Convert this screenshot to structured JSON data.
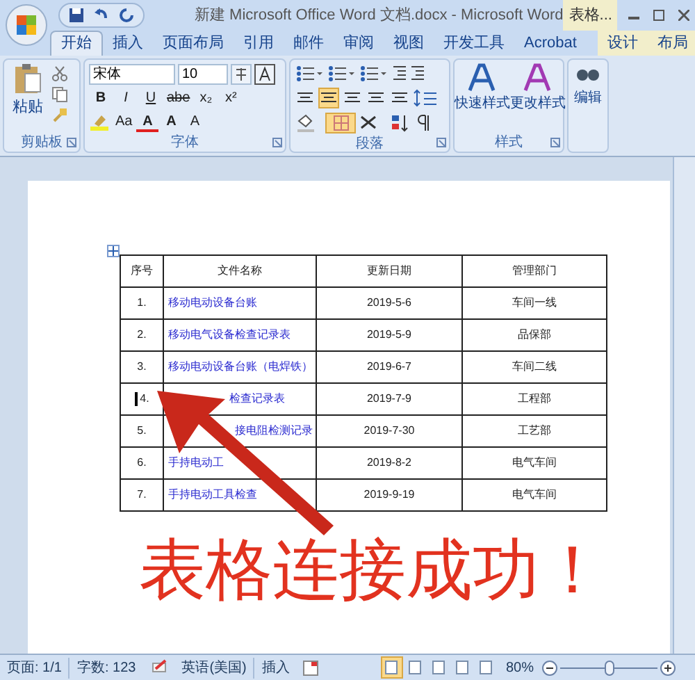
{
  "window": {
    "title": "新建 Microsoft Office Word 文档.docx - Microsoft Word",
    "context_tab": "表格..."
  },
  "tabs": [
    {
      "label": "开始",
      "selected": true,
      "kind": "normal"
    },
    {
      "label": "插入",
      "selected": false,
      "kind": "normal"
    },
    {
      "label": "页面布局",
      "selected": false,
      "kind": "normal"
    },
    {
      "label": "引用",
      "selected": false,
      "kind": "normal"
    },
    {
      "label": "邮件",
      "selected": false,
      "kind": "normal"
    },
    {
      "label": "审阅",
      "selected": false,
      "kind": "normal"
    },
    {
      "label": "视图",
      "selected": false,
      "kind": "normal"
    },
    {
      "label": "开发工具",
      "selected": false,
      "kind": "normal"
    },
    {
      "label": "Acrobat",
      "selected": false,
      "kind": "normal"
    },
    {
      "label": "设计",
      "selected": false,
      "kind": "context"
    },
    {
      "label": "布局",
      "selected": false,
      "kind": "context"
    }
  ],
  "ribbon": {
    "clipboard": {
      "paste": "粘贴",
      "group": "剪贴板"
    },
    "font": {
      "name": "宋体",
      "size": "10",
      "row2": [
        "B",
        "I",
        "U",
        "abe",
        "x₂",
        "x²"
      ],
      "row3": [
        "Aa",
        "A",
        "A",
        "A"
      ],
      "group": "字体"
    },
    "paragraph": {
      "group": "段落",
      "align": [
        {
          "selected": false
        },
        {
          "selected": true
        },
        {
          "selected": false
        },
        {
          "selected": false
        },
        {
          "selected": false
        }
      ],
      "borders_on": true
    },
    "styles": {
      "buttons": [
        "快速样式",
        "更改样式"
      ],
      "group": "样式"
    },
    "editing": {
      "label": "编辑"
    }
  },
  "table": {
    "columns": [
      "序号",
      "文件名称",
      "更新日期",
      "管理部门"
    ],
    "rows": [
      {
        "no": "1.",
        "name": "移动电动设备台账",
        "date": "2019-5-6",
        "dept": "车间一线"
      },
      {
        "no": "2.",
        "name": "移动电气设备检查记录表",
        "date": "2019-5-9",
        "dept": "品保部"
      },
      {
        "no": "3.",
        "name": "移动电动设备台账（电焊铁）",
        "date": "2019-6-7",
        "dept": "车间二线"
      },
      {
        "no": "4.",
        "name": "检查记录表",
        "date": "2019-7-9",
        "dept": "工程部",
        "cursor": true
      },
      {
        "no": "5.",
        "name": "接电阻检测记录",
        "date": "2019-7-30",
        "dept": "工艺部"
      },
      {
        "no": "6.",
        "name": "手持电动工",
        "date": "2019-8-2",
        "dept": "电气车间"
      },
      {
        "no": "7.",
        "name": "手持电动工具检查",
        "date": "2019-9-19",
        "dept": "电气车间"
      }
    ]
  },
  "annotation": {
    "text": "表格连接成功！"
  },
  "status_bar": {
    "page": "页面: 1/1",
    "words": "字数: 123",
    "language": "英语(美国)",
    "mode": "插入",
    "zoom": "80%",
    "views": [
      {
        "selected": true
      },
      {
        "selected": false
      },
      {
        "selected": false
      },
      {
        "selected": false
      },
      {
        "selected": false
      }
    ],
    "zoom_slider": {
      "level": 0.5
    }
  }
}
